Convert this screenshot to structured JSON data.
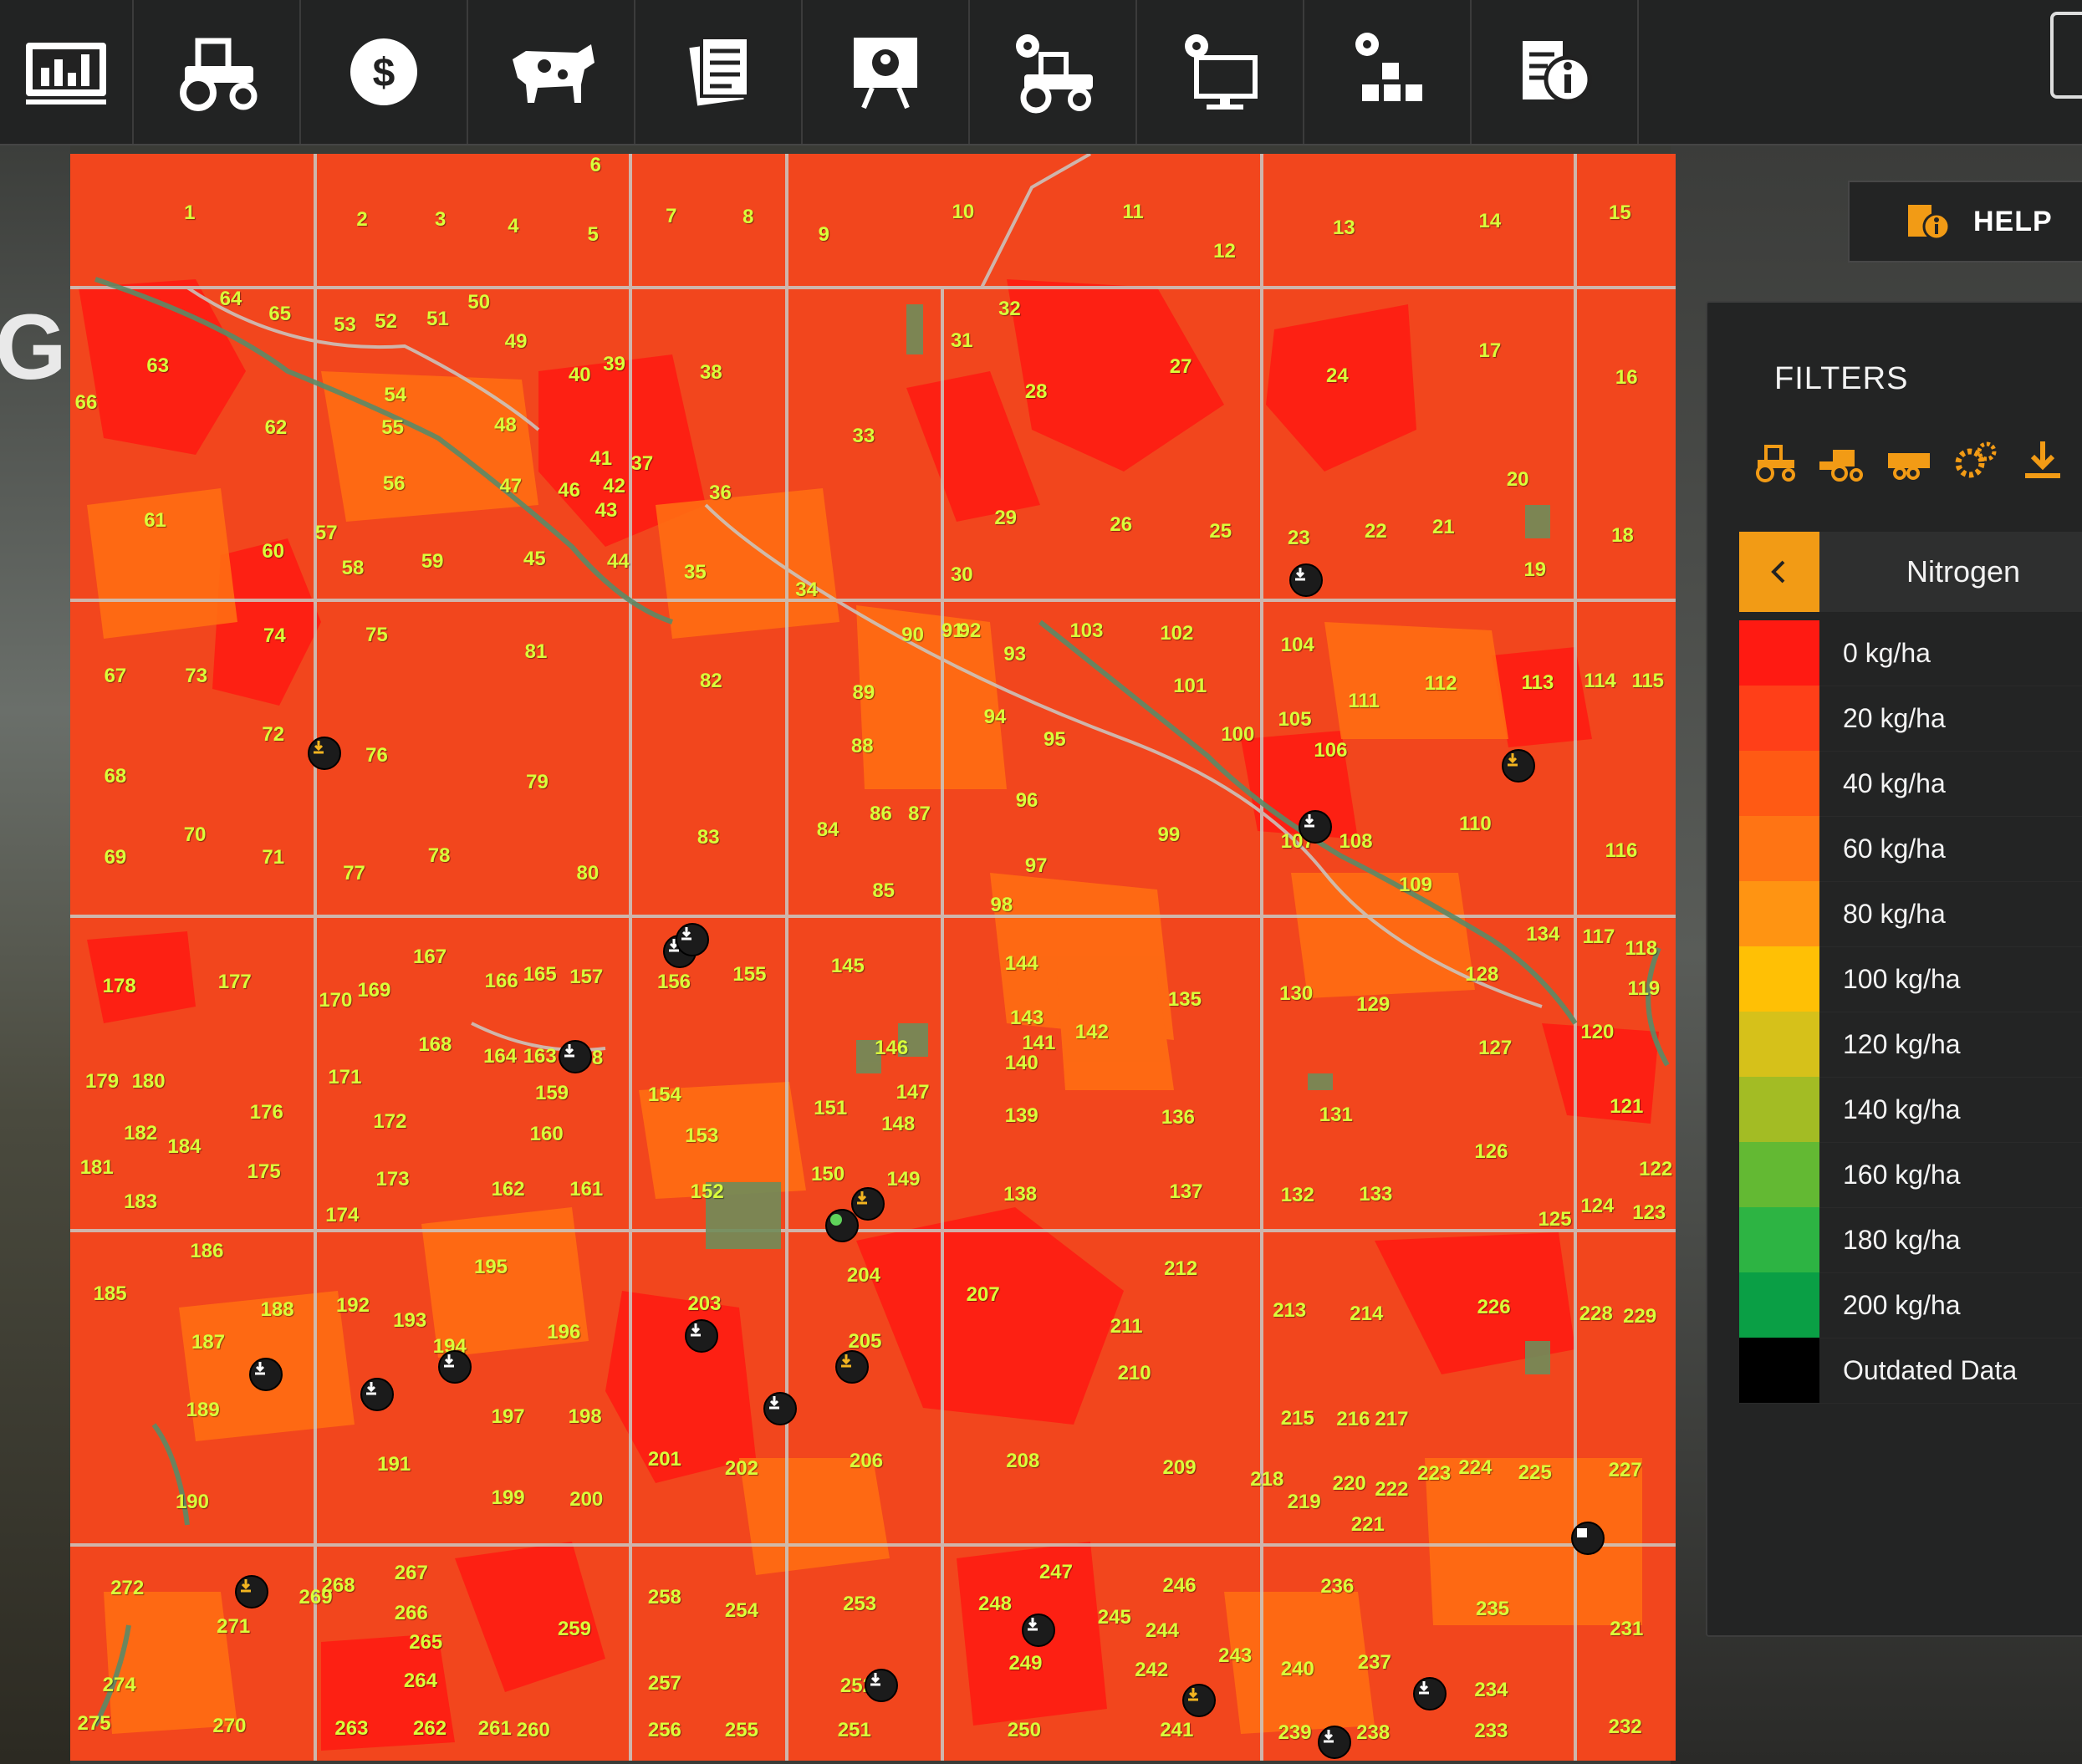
{
  "topbar": {
    "tabs": [
      {
        "name": "tab-statistics",
        "icon": "chart-icon"
      },
      {
        "name": "tab-vehicles",
        "icon": "tractor-icon"
      },
      {
        "name": "tab-finances",
        "icon": "dollar-icon"
      },
      {
        "name": "tab-animals",
        "icon": "cow-icon"
      },
      {
        "name": "tab-contracts",
        "icon": "documents-icon"
      },
      {
        "name": "tab-map",
        "icon": "map-presentation-icon"
      },
      {
        "name": "tab-vehicle-settings",
        "icon": "tractor-gear-icon"
      },
      {
        "name": "tab-game-settings",
        "icon": "monitor-gear-icon"
      },
      {
        "name": "tab-production",
        "icon": "boxes-gear-icon"
      },
      {
        "name": "tab-help",
        "icon": "info-document-icon"
      }
    ]
  },
  "help": {
    "label": "HELP"
  },
  "filters": {
    "title": "FILTERS",
    "icons": [
      "tractor-filter-icon",
      "harvester-filter-icon",
      "trailer-filter-icon",
      "tools-filter-icon",
      "unload-filter-icon"
    ],
    "selected": "Nitrogen",
    "legend": [
      {
        "label": "0 kg/ha",
        "color": "#ff1a12"
      },
      {
        "label": "20 kg/ha",
        "color": "#ff3f18"
      },
      {
        "label": "40 kg/ha",
        "color": "#ff5a14"
      },
      {
        "label": "60 kg/ha",
        "color": "#ff7414"
      },
      {
        "label": "80 kg/ha",
        "color": "#ff9412"
      },
      {
        "label": "100 kg/ha",
        "color": "#ffc005"
      },
      {
        "label": "120 kg/ha",
        "color": "#d6c11a"
      },
      {
        "label": "140 kg/ha",
        "color": "#a3bc24"
      },
      {
        "label": "160 kg/ha",
        "color": "#63b933"
      },
      {
        "label": "180 kg/ha",
        "color": "#2db443"
      },
      {
        "label": "200 kg/ha",
        "color": "#0a9f45"
      },
      {
        "label": "Outdated Data",
        "color": "#000000"
      }
    ]
  },
  "map": {
    "field_numbers": [
      [
        "1",
        142,
        161
      ],
      [
        "2",
        272,
        166
      ],
      [
        "3",
        331,
        166
      ],
      [
        "4",
        386,
        171
      ],
      [
        "5",
        446,
        177
      ],
      [
        "6",
        448,
        125
      ],
      [
        "7",
        505,
        163
      ],
      [
        "8",
        563,
        164
      ],
      [
        "9",
        620,
        177
      ],
      [
        "10",
        725,
        160
      ],
      [
        "11",
        853,
        160
      ],
      [
        "12",
        922,
        190
      ],
      [
        "13",
        1012,
        172
      ],
      [
        "14",
        1122,
        167
      ],
      [
        "15",
        1220,
        161
      ],
      [
        "64",
        173,
        226
      ],
      [
        "65",
        210,
        237
      ],
      [
        "53",
        259,
        245
      ],
      [
        "52",
        290,
        243
      ],
      [
        "51",
        329,
        241
      ],
      [
        "50",
        360,
        228
      ],
      [
        "49",
        388,
        258
      ],
      [
        "40",
        436,
        283
      ],
      [
        "39",
        462,
        275
      ],
      [
        "38",
        535,
        281
      ],
      [
        "32",
        760,
        233
      ],
      [
        "31",
        724,
        257
      ],
      [
        "28",
        780,
        296
      ],
      [
        "27",
        889,
        277
      ],
      [
        "24",
        1007,
        284
      ],
      [
        "17",
        1122,
        265
      ],
      [
        "16",
        1225,
        285
      ],
      [
        "63",
        118,
        276
      ],
      [
        "66",
        64,
        304
      ],
      [
        "54",
        297,
        298
      ],
      [
        "62",
        207,
        323
      ],
      [
        "55",
        295,
        323
      ],
      [
        "48",
        380,
        321
      ],
      [
        "33",
        650,
        329
      ],
      [
        "41",
        452,
        346
      ],
      [
        "37",
        483,
        350
      ],
      [
        "36",
        542,
        372
      ],
      [
        "56",
        296,
        365
      ],
      [
        "47",
        384,
        367
      ],
      [
        "46",
        428,
        370
      ],
      [
        "42",
        462,
        367
      ],
      [
        "43",
        456,
        385
      ],
      [
        "20",
        1143,
        362
      ],
      [
        "61",
        116,
        393
      ],
      [
        "57",
        245,
        402
      ],
      [
        "60",
        205,
        416
      ],
      [
        "58",
        265,
        429
      ],
      [
        "59",
        325,
        424
      ],
      [
        "45",
        402,
        422
      ],
      [
        "44",
        465,
        424
      ],
      [
        "29",
        757,
        391
      ],
      [
        "26",
        844,
        396
      ],
      [
        "25",
        919,
        401
      ],
      [
        "23",
        978,
        406
      ],
      [
        "22",
        1036,
        401
      ],
      [
        "21",
        1087,
        398
      ],
      [
        "18",
        1222,
        404
      ],
      [
        "35",
        523,
        432
      ],
      [
        "34",
        607,
        445
      ],
      [
        "30",
        724,
        434
      ],
      [
        "19",
        1156,
        430
      ],
      [
        "74",
        206,
        480
      ],
      [
        "75",
        283,
        479
      ],
      [
        "81",
        403,
        492
      ],
      [
        "90",
        687,
        479
      ],
      [
        "91",
        717,
        476
      ],
      [
        "92",
        730,
        476
      ],
      [
        "103",
        818,
        476
      ],
      [
        "102",
        886,
        478
      ],
      [
        "104",
        977,
        487
      ],
      [
        "93",
        764,
        494
      ],
      [
        "67",
        86,
        510
      ],
      [
        "73",
        147,
        510
      ],
      [
        "82",
        535,
        514
      ],
      [
        "101",
        896,
        518
      ],
      [
        "112",
        1085,
        516
      ],
      [
        "113",
        1158,
        515
      ],
      [
        "114",
        1205,
        514
      ],
      [
        "115",
        1241,
        514
      ],
      [
        "89",
        650,
        523
      ],
      [
        "111",
        1027,
        529
      ],
      [
        "72",
        205,
        554
      ],
      [
        "94",
        749,
        541
      ],
      [
        "105",
        975,
        543
      ],
      [
        "100",
        932,
        554
      ],
      [
        "95",
        794,
        558
      ],
      [
        "88",
        649,
        563
      ],
      [
        "106",
        1002,
        566
      ],
      [
        "76",
        283,
        570
      ],
      [
        "68",
        86,
        586
      ],
      [
        "79",
        404,
        590
      ],
      [
        "96",
        773,
        604
      ],
      [
        "86",
        663,
        614
      ],
      [
        "87",
        692,
        614
      ],
      [
        "84",
        623,
        626
      ],
      [
        "110",
        1111,
        622
      ],
      [
        "70",
        146,
        630
      ],
      [
        "83",
        533,
        632
      ],
      [
        "99",
        880,
        630
      ],
      [
        "107",
        977,
        635
      ],
      [
        "108",
        1021,
        635
      ],
      [
        "116",
        1221,
        642
      ],
      [
        "69",
        86,
        647
      ],
      [
        "71",
        205,
        647
      ],
      [
        "78",
        330,
        646
      ],
      [
        "77",
        266,
        659
      ],
      [
        "80",
        442,
        659
      ],
      [
        "97",
        780,
        653
      ],
      [
        "109",
        1066,
        668
      ],
      [
        "85",
        665,
        672
      ],
      [
        "98",
        754,
        683
      ],
      [
        "134",
        1162,
        705
      ],
      [
        "117",
        1204,
        707
      ],
      [
        "118",
        1236,
        716
      ],
      [
        "167",
        323,
        722
      ],
      [
        "145",
        638,
        729
      ],
      [
        "144",
        769,
        727
      ],
      [
        "155",
        564,
        735
      ],
      [
        "165",
        406,
        735
      ],
      [
        "157",
        441,
        737
      ],
      [
        "128",
        1116,
        735
      ],
      [
        "178",
        89,
        744
      ],
      [
        "177",
        176,
        741
      ],
      [
        "166",
        377,
        740
      ],
      [
        "156",
        507,
        741
      ],
      [
        "119",
        1238,
        746
      ],
      [
        "170",
        252,
        755
      ],
      [
        "169",
        281,
        747
      ],
      [
        "135",
        892,
        754
      ],
      [
        "130",
        976,
        750
      ],
      [
        "129",
        1034,
        758
      ],
      [
        "143",
        773,
        768
      ],
      [
        "142",
        822,
        779
      ],
      [
        "141",
        782,
        787
      ],
      [
        "120",
        1203,
        779
      ],
      [
        "168",
        327,
        788
      ],
      [
        "164",
        376,
        797
      ],
      [
        "163",
        406,
        797
      ],
      [
        "158",
        441,
        798
      ],
      [
        "146",
        671,
        791
      ],
      [
        "127",
        1126,
        791
      ],
      [
        "140",
        769,
        802
      ],
      [
        "179",
        76,
        816
      ],
      [
        "180",
        111,
        816
      ],
      [
        "171",
        259,
        813
      ],
      [
        "159",
        415,
        825
      ],
      [
        "154",
        500,
        826
      ],
      [
        "147",
        687,
        824
      ],
      [
        "151",
        625,
        836
      ],
      [
        "131",
        1006,
        841
      ],
      [
        "121",
        1225,
        835
      ],
      [
        "176",
        200,
        839
      ],
      [
        "172",
        293,
        846
      ],
      [
        "139",
        769,
        842
      ],
      [
        "136",
        887,
        843
      ],
      [
        "148",
        676,
        848
      ],
      [
        "160",
        411,
        856
      ],
      [
        "153",
        528,
        857
      ],
      [
        "182",
        105,
        855
      ],
      [
        "184",
        138,
        865
      ],
      [
        "126",
        1123,
        869
      ],
      [
        "181",
        72,
        881
      ],
      [
        "175",
        198,
        884
      ],
      [
        "173",
        295,
        890
      ],
      [
        "150",
        623,
        886
      ],
      [
        "149",
        680,
        890
      ],
      [
        "122",
        1247,
        882
      ],
      [
        "162",
        382,
        897
      ],
      [
        "161",
        441,
        897
      ],
      [
        "152",
        532,
        899
      ],
      [
        "137",
        893,
        899
      ],
      [
        "138",
        768,
        901
      ],
      [
        "132",
        977,
        902
      ],
      [
        "133",
        1036,
        901
      ],
      [
        "183",
        105,
        907
      ],
      [
        "124",
        1203,
        910
      ],
      [
        "123",
        1242,
        915
      ],
      [
        "125",
        1171,
        920
      ],
      [
        "174",
        257,
        917
      ],
      [
        "186",
        155,
        944
      ],
      [
        "195",
        369,
        956
      ],
      [
        "204",
        650,
        962
      ],
      [
        "212",
        889,
        957
      ],
      [
        "207",
        740,
        977
      ],
      [
        "185",
        82,
        976
      ],
      [
        "188",
        208,
        988
      ],
      [
        "192",
        265,
        985
      ],
      [
        "193",
        308,
        996
      ],
      [
        "203",
        530,
        984
      ],
      [
        "213",
        971,
        989
      ],
      [
        "214",
        1029,
        991
      ],
      [
        "226",
        1125,
        986
      ],
      [
        "228",
        1202,
        991
      ],
      [
        "229",
        1235,
        993
      ],
      [
        "187",
        156,
        1013
      ],
      [
        "194",
        338,
        1016
      ],
      [
        "196",
        424,
        1005
      ],
      [
        "205",
        651,
        1012
      ],
      [
        "211",
        848,
        1001
      ],
      [
        "210",
        854,
        1036
      ],
      [
        "189",
        152,
        1064
      ],
      [
        "197",
        382,
        1069
      ],
      [
        "198",
        440,
        1069
      ],
      [
        "215",
        977,
        1070
      ],
      [
        "216",
        1019,
        1071
      ],
      [
        "217",
        1048,
        1071
      ],
      [
        "191",
        296,
        1105
      ],
      [
        "201",
        500,
        1101
      ],
      [
        "202",
        558,
        1108
      ],
      [
        "206",
        652,
        1102
      ],
      [
        "208",
        770,
        1102
      ],
      [
        "209",
        888,
        1107
      ],
      [
        "223",
        1080,
        1112
      ],
      [
        "224",
        1111,
        1107
      ],
      [
        "225",
        1156,
        1111
      ],
      [
        "227",
        1224,
        1109
      ],
      [
        "190",
        144,
        1133
      ],
      [
        "199",
        382,
        1130
      ],
      [
        "200",
        441,
        1131
      ],
      [
        "218",
        954,
        1116
      ],
      [
        "220",
        1016,
        1119
      ],
      [
        "222",
        1048,
        1124
      ],
      [
        "219",
        982,
        1133
      ],
      [
        "221",
        1030,
        1150
      ],
      [
        "247",
        795,
        1186
      ],
      [
        "267",
        309,
        1187
      ],
      [
        "268",
        254,
        1196
      ],
      [
        "269",
        237,
        1205
      ],
      [
        "272",
        95,
        1198
      ],
      [
        "258",
        500,
        1205
      ],
      [
        "254",
        558,
        1215
      ],
      [
        "253",
        647,
        1210
      ],
      [
        "248",
        749,
        1210
      ],
      [
        "246",
        888,
        1196
      ],
      [
        "236",
        1007,
        1197
      ],
      [
        "235",
        1124,
        1214
      ],
      [
        "245",
        839,
        1220
      ],
      [
        "266",
        309,
        1217
      ],
      [
        "271",
        175,
        1227
      ],
      [
        "259",
        432,
        1229
      ],
      [
        "244",
        875,
        1230
      ],
      [
        "231",
        1225,
        1229
      ],
      [
        "265",
        320,
        1239
      ],
      [
        "243",
        930,
        1249
      ],
      [
        "249",
        772,
        1255
      ],
      [
        "242",
        867,
        1260
      ],
      [
        "240",
        977,
        1259
      ],
      [
        "237",
        1035,
        1254
      ],
      [
        "274",
        89,
        1271
      ],
      [
        "264",
        316,
        1268
      ],
      [
        "257",
        500,
        1270
      ],
      [
        "252",
        645,
        1272
      ],
      [
        "234",
        1123,
        1275
      ],
      [
        "275",
        70,
        1300
      ],
      [
        "270",
        172,
        1302
      ],
      [
        "263",
        264,
        1304
      ],
      [
        "262",
        323,
        1304
      ],
      [
        "261",
        372,
        1304
      ],
      [
        "260",
        401,
        1305
      ],
      [
        "256",
        500,
        1305
      ],
      [
        "255",
        558,
        1305
      ],
      [
        "251",
        643,
        1305
      ],
      [
        "250",
        771,
        1305
      ],
      [
        "241",
        886,
        1305
      ],
      [
        "239",
        975,
        1307
      ],
      [
        "238",
        1034,
        1307
      ],
      [
        "233",
        1123,
        1306
      ],
      [
        "232",
        1224,
        1303
      ]
    ]
  }
}
